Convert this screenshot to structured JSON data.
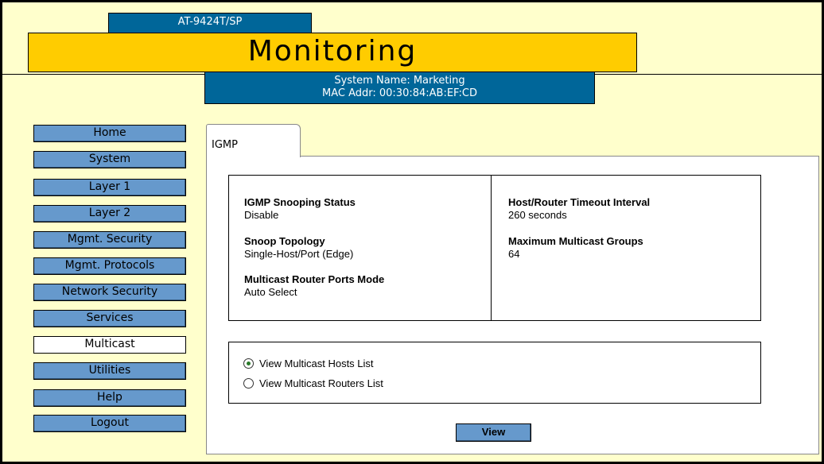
{
  "header": {
    "model": "AT-9424T/SP",
    "title": "Monitoring",
    "system_name": "System Name: Marketing",
    "mac_addr": "MAC Addr: 00:30:84:AB:EF:CD"
  },
  "nav": {
    "items": [
      {
        "label": "Home"
      },
      {
        "label": "System"
      },
      {
        "label": "Layer 1"
      },
      {
        "label": "Layer 2"
      },
      {
        "label": "Mgmt. Security"
      },
      {
        "label": "Mgmt. Protocols"
      },
      {
        "label": "Network Security"
      },
      {
        "label": "Services"
      },
      {
        "label": "Multicast",
        "active": true
      },
      {
        "label": "Utilities"
      },
      {
        "label": "Help"
      },
      {
        "label": "Logout"
      }
    ]
  },
  "tab": {
    "label": "IGMP"
  },
  "igmp": {
    "snooping_status_label": "IGMP Snooping Status",
    "snooping_status_value": "Disable",
    "snoop_topology_label": "Snoop Topology",
    "snoop_topology_value": "Single-Host/Port (Edge)",
    "router_ports_mode_label": "Multicast Router Ports Mode",
    "router_ports_mode_value": "Auto Select",
    "timeout_label": "Host/Router Timeout Interval",
    "timeout_value": "260 seconds",
    "max_groups_label": "Maximum Multicast Groups",
    "max_groups_value": "64"
  },
  "options": {
    "hosts_label": "View Multicast Hosts List",
    "routers_label": "View Multicast Routers List",
    "selected": "hosts"
  },
  "actions": {
    "view_label": "View"
  },
  "colors": {
    "background": "#FFFFCC",
    "title_bar": "#FFCC00",
    "header_blue": "#006699",
    "nav_button": "#6699CC"
  }
}
